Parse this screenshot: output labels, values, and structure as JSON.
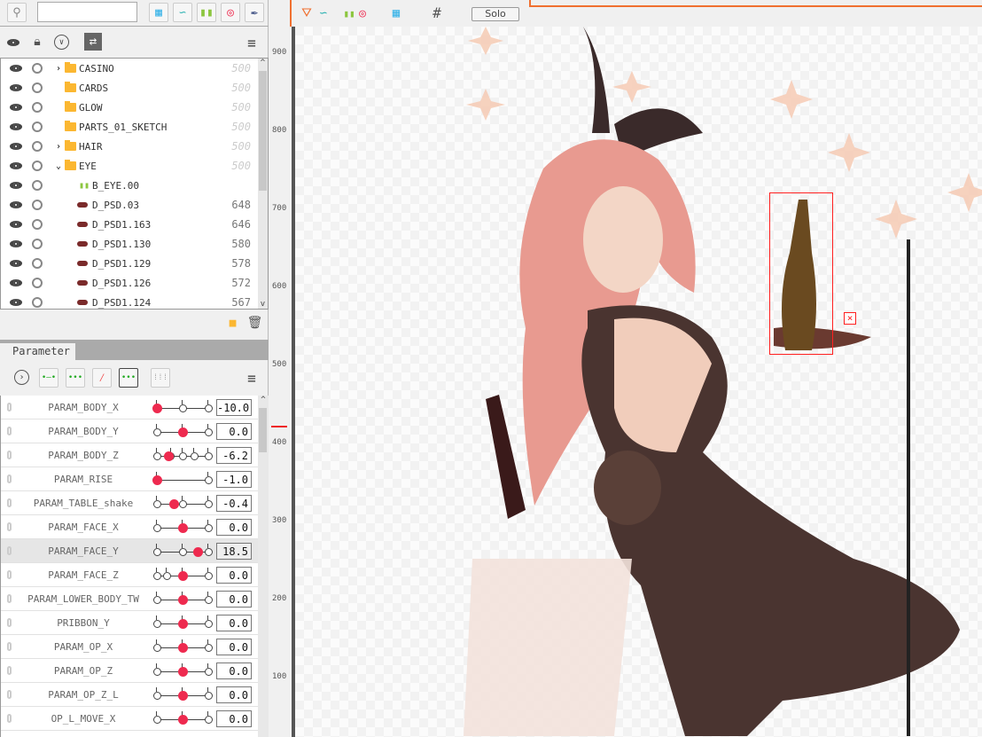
{
  "parts_panel": {
    "search_value": "",
    "rows": [
      {
        "name": "CASINO",
        "order": "500",
        "type": "folder",
        "expander": "collapsed",
        "dim": true
      },
      {
        "name": "CARDS",
        "order": "500",
        "type": "folder",
        "expander": "none",
        "dim": true
      },
      {
        "name": "GLOW",
        "order": "500",
        "type": "folder",
        "expander": "none",
        "dim": true
      },
      {
        "name": "PARTS_01_SKETCH",
        "order": "500",
        "type": "folder",
        "expander": "none",
        "dim": true
      },
      {
        "name": "HAIR",
        "order": "500",
        "type": "folder",
        "expander": "collapsed",
        "dim": true
      },
      {
        "name": "EYE",
        "order": "500",
        "type": "folder",
        "expander": "expanded",
        "dim": true
      },
      {
        "name": "B_EYE.00",
        "order": "",
        "type": "deformer",
        "expander": "none",
        "dim": false
      },
      {
        "name": "D_PSD.03",
        "order": "648",
        "type": "artmesh",
        "expander": "none",
        "dim": false
      },
      {
        "name": "D_PSD1.163",
        "order": "646",
        "type": "artmesh",
        "expander": "none",
        "dim": false
      },
      {
        "name": "D_PSD1.130",
        "order": "580",
        "type": "artmesh",
        "expander": "none",
        "dim": false
      },
      {
        "name": "D_PSD1.129",
        "order": "578",
        "type": "artmesh",
        "expander": "none",
        "dim": false
      },
      {
        "name": "D_PSD1.126",
        "order": "572",
        "type": "artmesh",
        "expander": "none",
        "dim": false
      },
      {
        "name": "D_PSD1.124",
        "order": "567",
        "type": "artmesh",
        "expander": "none",
        "dim": false
      }
    ]
  },
  "parameter_panel": {
    "tab_label": "Parameter",
    "params": [
      {
        "name": "PARAM_BODY_X",
        "value": "-10.0",
        "keys": [
          0,
          0.5,
          1
        ],
        "level": 0
      },
      {
        "name": "PARAM_BODY_Y",
        "value": "0.0",
        "keys": [
          0,
          0.5,
          1
        ],
        "level": 0.5
      },
      {
        "name": "PARAM_BODY_Z",
        "value": "-6.2",
        "keys": [
          0,
          0.27,
          0.5,
          0.73,
          1
        ],
        "level": 0.24
      },
      {
        "name": "PARAM_RISE",
        "value": "-1.0",
        "keys": [
          0,
          1
        ],
        "level": 0
      },
      {
        "name": "PARAM_TABLE_shake",
        "value": "-0.4",
        "keys": [
          0,
          0.5,
          1
        ],
        "level": 0.34
      },
      {
        "name": "PARAM_FACE_X",
        "value": "0.0",
        "keys": [
          0,
          0.5,
          1
        ],
        "level": 0.5
      },
      {
        "name": "PARAM_FACE_Y",
        "value": "18.5",
        "keys": [
          0,
          0.5,
          1
        ],
        "level": 0.8,
        "selected": true
      },
      {
        "name": "PARAM_FACE_Z",
        "value": "0.0",
        "keys": [
          0,
          0.19,
          0.5,
          1
        ],
        "level": 0.5
      },
      {
        "name": "PARAM_LOWER_BODY_TW",
        "value": "0.0",
        "keys": [
          0,
          0.5,
          1
        ],
        "level": 0.5
      },
      {
        "name": "PRIBBON_Y",
        "value": "0.0",
        "keys": [
          0,
          0.5,
          1
        ],
        "level": 0.5
      },
      {
        "name": "PARAM_OP_X",
        "value": "0.0",
        "keys": [
          0,
          0.5,
          1
        ],
        "level": 0.5
      },
      {
        "name": "PARAM_OP_Z",
        "value": "0.0",
        "keys": [
          0,
          0.5,
          1
        ],
        "level": 0.5
      },
      {
        "name": "PARAM_OP_Z_L",
        "value": "0.0",
        "keys": [
          0,
          0.5,
          1
        ],
        "level": 0.5
      },
      {
        "name": "OP_L_MOVE_X",
        "value": "0.0",
        "keys": [
          0,
          0.5,
          1
        ],
        "level": 0.5
      }
    ]
  },
  "view": {
    "solo_label": "Solo",
    "ruler_labels": [
      "900",
      "800",
      "700",
      "600",
      "500",
      "400",
      "300",
      "200",
      "100"
    ]
  },
  "colors": {
    "accent": "#f07030",
    "handle": "#ee2a4f",
    "folder": "#fbb731",
    "selection": "#ff2020"
  }
}
